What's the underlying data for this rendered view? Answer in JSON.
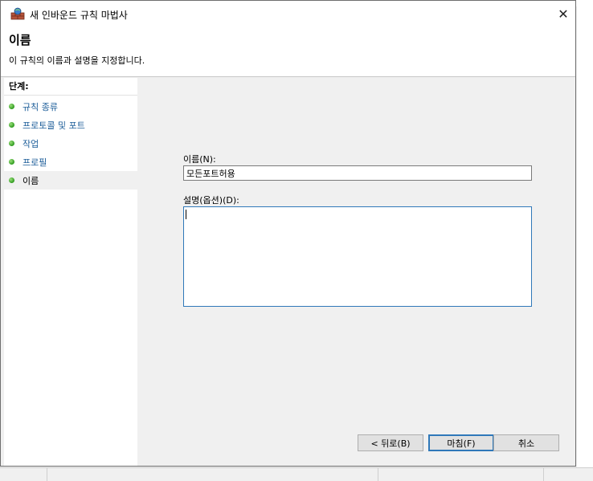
{
  "window": {
    "title": "새 인바운드 규칙 마법사",
    "close_glyph": "✕"
  },
  "header": {
    "title": "이름",
    "description": "이 규칙의 이름과 설명을 지정합니다."
  },
  "steps": {
    "title": "단계:",
    "items": [
      {
        "label": "규칙 종류"
      },
      {
        "label": "프로토콜 및 포트"
      },
      {
        "label": "작업"
      },
      {
        "label": "프로필"
      },
      {
        "label": "이름"
      }
    ],
    "current_index": 4
  },
  "form": {
    "name_label": "이름(N):",
    "name_value": "모든포트허용",
    "desc_label": "설명(옵션)(D):",
    "desc_value": ""
  },
  "buttons": {
    "back": "< 뒤로(B)",
    "finish": "마침(F)",
    "cancel": "취소"
  },
  "colors": {
    "step_link": "#1c5d99",
    "focus_border": "#2f78b9",
    "step_dot": "#2e9a1e"
  },
  "icons": {
    "app": "firewall-wall-icon",
    "step": "green-dot-icon"
  }
}
